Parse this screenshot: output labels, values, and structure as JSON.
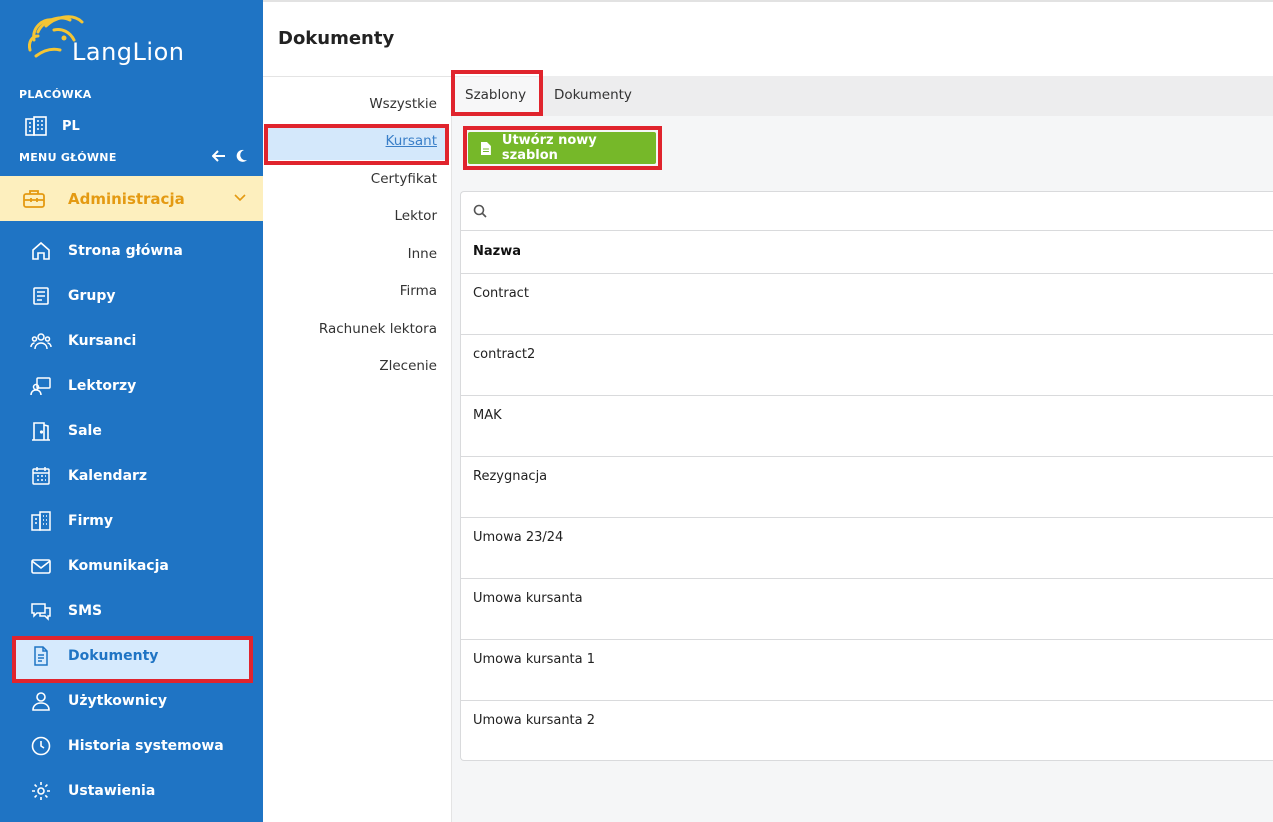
{
  "brand": {
    "name": "LangLion"
  },
  "sidebar": {
    "placowka_label": "PLACÓWKA",
    "placowka_value": "PL",
    "menu_label": "MENU GŁÓWNE",
    "section": "Administracja",
    "items": [
      {
        "label": "Strona główna",
        "icon": "home-icon"
      },
      {
        "label": "Grupy",
        "icon": "book-icon"
      },
      {
        "label": "Kursanci",
        "icon": "users-icon"
      },
      {
        "label": "Lektorzy",
        "icon": "teacher-icon"
      },
      {
        "label": "Sale",
        "icon": "door-icon"
      },
      {
        "label": "Kalendarz",
        "icon": "calendar-icon"
      },
      {
        "label": "Firmy",
        "icon": "building-icon"
      },
      {
        "label": "Komunikacja",
        "icon": "mail-icon"
      },
      {
        "label": "SMS",
        "icon": "chat-icon"
      },
      {
        "label": "Dokumenty",
        "icon": "document-icon",
        "active": true
      },
      {
        "label": "Użytkownicy",
        "icon": "user-icon"
      },
      {
        "label": "Historia systemowa",
        "icon": "clock-icon"
      },
      {
        "label": "Ustawienia",
        "icon": "gear-icon"
      }
    ]
  },
  "header": {
    "title": "Dokumenty"
  },
  "categories": [
    {
      "label": "Wszystkie"
    },
    {
      "label": "Kursant",
      "active": true
    },
    {
      "label": "Certyfikat"
    },
    {
      "label": "Lektor"
    },
    {
      "label": "Inne"
    },
    {
      "label": "Firma"
    },
    {
      "label": "Rachunek lektora"
    },
    {
      "label": "Zlecenie"
    }
  ],
  "tabs": [
    {
      "label": "Szablony",
      "active": true
    },
    {
      "label": "Dokumenty"
    }
  ],
  "actions": {
    "create_template_label": "Utwórz nowy szablon"
  },
  "search": {
    "placeholder": ""
  },
  "table": {
    "header": "Nazwa",
    "rows": [
      "Contract",
      "contract2",
      "MAK",
      "Rezygnacja",
      "Umowa 23/24",
      "Umowa kursanta",
      "Umowa kursanta 1",
      "Umowa kursanta 2"
    ]
  },
  "colors": {
    "sidebar": "#1f74c4",
    "admin_highlight": "#fdefbe",
    "admin_text": "#e49a12",
    "create_button": "#76b829",
    "annotation_red": "#e0242d"
  }
}
